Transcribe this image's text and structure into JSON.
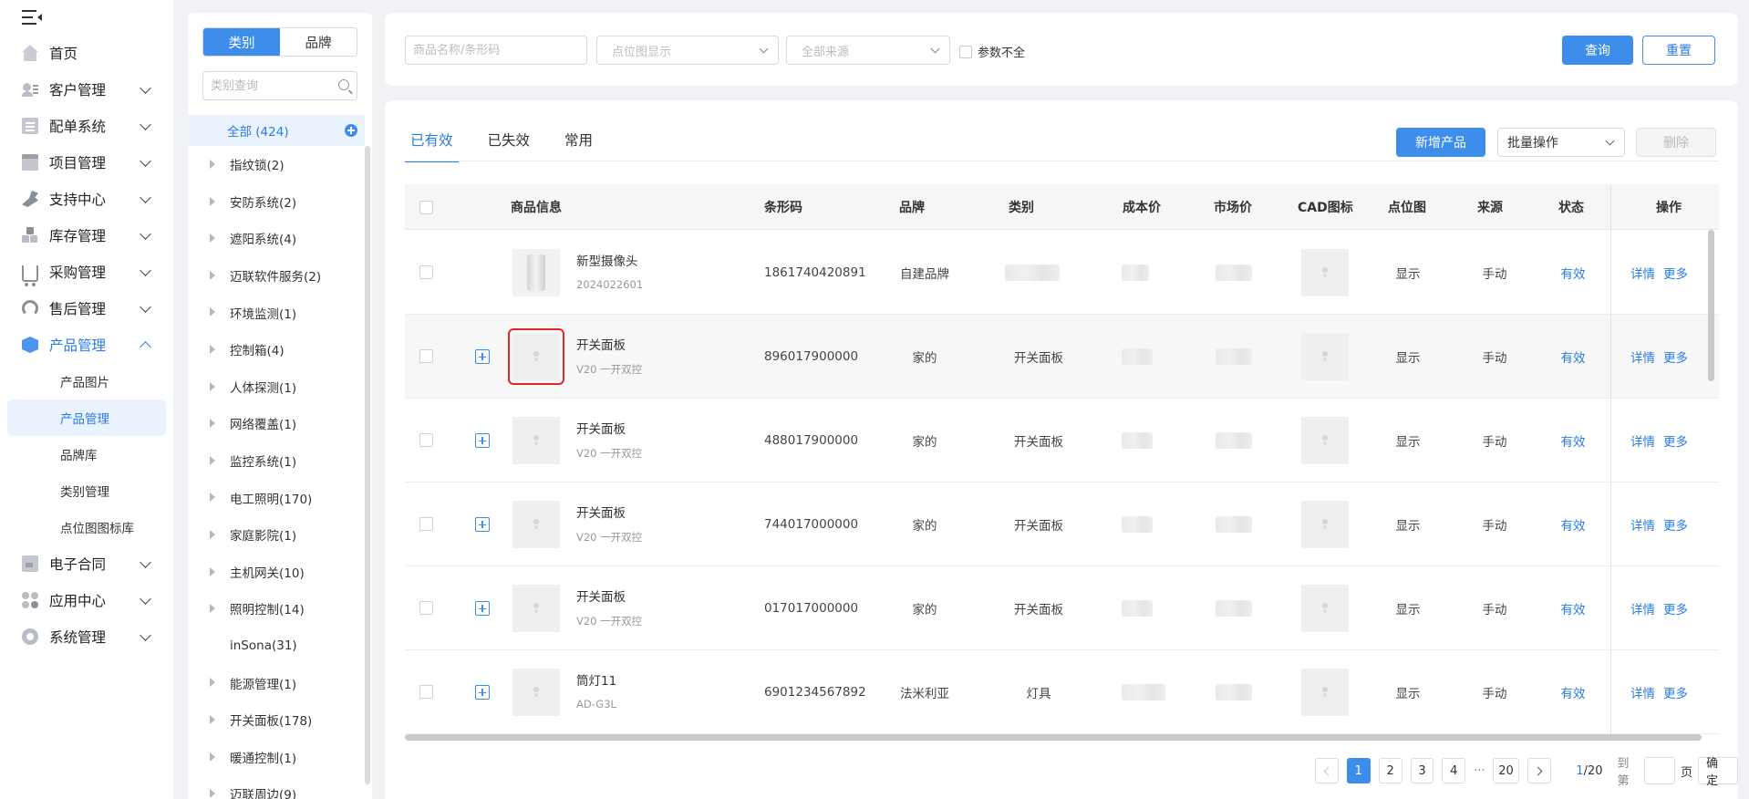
{
  "nav": {
    "items": [
      {
        "label": "首页",
        "icon": "home-icon"
      },
      {
        "label": "客户管理",
        "icon": "customer-icon"
      },
      {
        "label": "配单系统",
        "icon": "order-icon"
      },
      {
        "label": "项目管理",
        "icon": "folder-icon"
      },
      {
        "label": "支持中心",
        "icon": "wrench-icon"
      },
      {
        "label": "库存管理",
        "icon": "stock-icon"
      },
      {
        "label": "采购管理",
        "icon": "cart-icon"
      },
      {
        "label": "售后管理",
        "icon": "headset-icon"
      },
      {
        "label": "产品管理",
        "icon": "box-icon"
      },
      {
        "label": "电子合同",
        "icon": "contract-icon"
      },
      {
        "label": "应用中心",
        "icon": "apps-icon"
      },
      {
        "label": "系统管理",
        "icon": "gear-icon"
      }
    ],
    "sub_items": [
      "产品图片",
      "产品管理",
      "品牌库",
      "类别管理",
      "点位图图标库"
    ],
    "active_sub": "产品管理"
  },
  "category": {
    "seg_category": "类别",
    "seg_brand": "品牌",
    "search_placeholder": "类别查询",
    "all": "全部 (424)",
    "nodes": [
      "指纹锁(2)",
      "安防系统(2)",
      "遮阳系统(4)",
      "迈联软件服务(2)",
      "环境监测(1)",
      "控制箱(4)",
      "人体探测(1)",
      "网络覆盖(1)",
      "监控系统(1)",
      "电工照明(170)",
      "家庭影院(1)",
      "主机网关(10)",
      "照明控制(14)",
      "inSona(31)",
      "能源管理(1)",
      "开关面板(178)",
      "暖通控制(1)",
      "迈联周边(9)"
    ]
  },
  "filter": {
    "name_placeholder": "商品名称/条形码",
    "pos_placeholder": "点位图显示",
    "source_placeholder": "全部来源",
    "incomplete_label": "参数不全",
    "query": "查询",
    "reset": "重置"
  },
  "main": {
    "tabs": [
      "已有效",
      "已失效",
      "常用"
    ],
    "add_product": "新增产品",
    "bulk": "批量操作",
    "delete": "删除",
    "columns": [
      "商品信息",
      "条形码",
      "品牌",
      "类别",
      "成本价",
      "市场价",
      "CAD图标",
      "点位图",
      "来源",
      "状态",
      "操作"
    ],
    "rows": [
      {
        "name": "新型摄像头",
        "code": "2024022601",
        "barcode": "1861740420891",
        "brand": "自建品牌",
        "category": "",
        "pos": "显示",
        "source": "手动",
        "status": "有效",
        "detail": "详情",
        "more": "更多"
      },
      {
        "name": "开关面板",
        "code": "V20 一开双控",
        "barcode": "896017900000",
        "brand": "家的",
        "category": "开关面板",
        "pos": "显示",
        "source": "手动",
        "status": "有效",
        "detail": "详情",
        "more": "更多"
      },
      {
        "name": "开关面板",
        "code": "V20 一开双控",
        "barcode": "488017900000",
        "brand": "家的",
        "category": "开关面板",
        "pos": "显示",
        "source": "手动",
        "status": "有效",
        "detail": "详情",
        "more": "更多"
      },
      {
        "name": "开关面板",
        "code": "V20 一开双控",
        "barcode": "744017000000",
        "brand": "家的",
        "category": "开关面板",
        "pos": "显示",
        "source": "手动",
        "status": "有效",
        "detail": "详情",
        "more": "更多"
      },
      {
        "name": "开关面板",
        "code": "V20 一开双控",
        "barcode": "017017000000",
        "brand": "家的",
        "category": "开关面板",
        "pos": "显示",
        "source": "手动",
        "status": "有效",
        "detail": "详情",
        "more": "更多"
      },
      {
        "name": "筒灯11",
        "code": "AD-G3L",
        "barcode": "6901234567892",
        "brand": "法米利亚",
        "category": "灯具",
        "pos": "显示",
        "source": "手动",
        "status": "有效",
        "detail": "详情",
        "more": "更多"
      }
    ]
  },
  "pager": {
    "pages": [
      "1",
      "2",
      "3",
      "4"
    ],
    "ellipsis": "···",
    "last": "20",
    "current": "1",
    "total": "/20",
    "goto": "到第",
    "page_unit": "页",
    "confirm": "确定"
  },
  "colors": {
    "accent": "#3d8eea",
    "highlight": "#e0252b"
  }
}
